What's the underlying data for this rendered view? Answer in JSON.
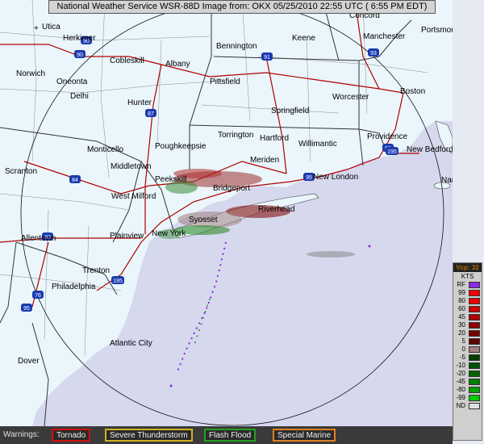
{
  "header": {
    "title": "National Weather Service WSR-88D Image from: OKX 05/25/2010 22:55 UTC ( 6:55 PM EDT)"
  },
  "map": {
    "places": [
      "Concord",
      "Utica",
      "Herkimer",
      "Portsmouth",
      "Manchester",
      "Keene",
      "Bennington",
      "Cobleskill",
      "Albany",
      "Norwich",
      "Oneonta",
      "Delhi",
      "Pittsfield",
      "Worcester",
      "Boston",
      "Hunter",
      "Springfield",
      "Torrington",
      "Hartford",
      "Willimantic",
      "Providence",
      "New Bedford",
      "Monticello",
      "Poughkeepsie",
      "Meriden",
      "Middletown",
      "Scranton",
      "Peekskill",
      "Bridgeport",
      "New London",
      "Nantucket",
      "West Milford",
      "Riverhead",
      "Syosset",
      "Allentown",
      "Plainview",
      "New York",
      "Trenton",
      "Philadelphia",
      "Atlantic City",
      "Dover"
    ],
    "highways": [
      "90",
      "90",
      "87",
      "91",
      "93",
      "95",
      "195",
      "84",
      "95",
      "80",
      "195",
      "76",
      "95"
    ],
    "colors": {
      "land": "#eaf6fb",
      "water": "#d6d8ee",
      "state_border": "#333333",
      "county_border": "#888888",
      "highway": "#b00000",
      "range_ring": "#000000"
    }
  },
  "legend": {
    "header": "Vcp: 32",
    "units": "KTS",
    "entries": [
      {
        "label": "RF",
        "color": "#8a2be2"
      },
      {
        "label": "99",
        "color": "#ff0000"
      },
      {
        "label": "80",
        "color": "#ee0000"
      },
      {
        "label": "60",
        "color": "#d00000"
      },
      {
        "label": "45",
        "color": "#b00000"
      },
      {
        "label": "30",
        "color": "#900000"
      },
      {
        "label": "20",
        "color": "#7a0000"
      },
      {
        "label": "5",
        "color": "#600000"
      },
      {
        "label": "0",
        "color": "#a08080"
      },
      {
        "label": "-5",
        "color": "#004000"
      },
      {
        "label": "-10",
        "color": "#005000"
      },
      {
        "label": "-20",
        "color": "#006400"
      },
      {
        "label": "-45",
        "color": "#008000"
      },
      {
        "label": "-80",
        "color": "#00a000"
      },
      {
        "label": "-99",
        "color": "#00cc00"
      },
      {
        "label": "ND",
        "color": "#e0e0e0"
      }
    ]
  },
  "warnings": {
    "label": "Warnings:",
    "items": [
      {
        "label": "Tornado",
        "color": "#d01010"
      },
      {
        "label": "Severe Thunderstorm",
        "color": "#d0b020"
      },
      {
        "label": "Flash Flood",
        "color": "#20a020"
      },
      {
        "label": "Special Marine",
        "color": "#e08020"
      }
    ]
  }
}
